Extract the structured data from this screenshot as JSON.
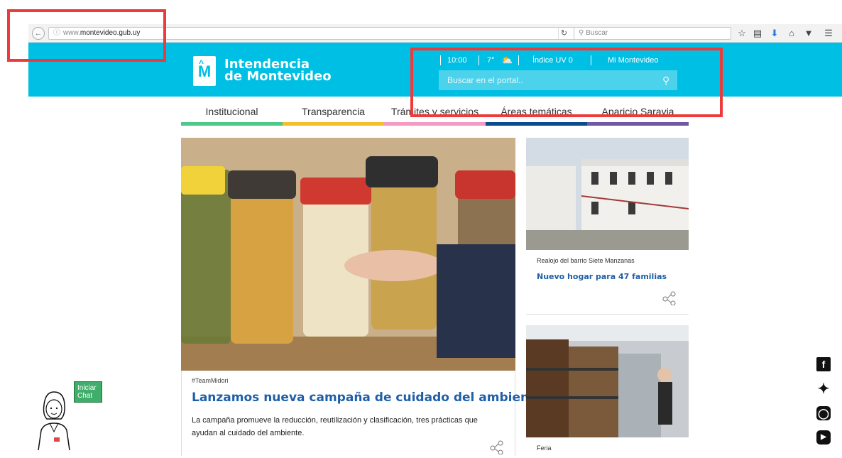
{
  "browser": {
    "url_prefix": "www.",
    "url_host": "montevideo.gub.uy",
    "search_placeholder": "Buscar",
    "info_icon": "info-icon",
    "back_icon": "back-arrow-icon",
    "reload_icon": "reload-icon"
  },
  "header": {
    "logo_letter": "M",
    "logo_line1": "Intendencia",
    "logo_line2": "de Montevideo",
    "time": "10:00",
    "temperature": "7°",
    "uv_index": "Índice UV 0",
    "account_link": "Mi Montevideo",
    "portal_search_placeholder": "Buscar en el portal..",
    "accent_color": "#00bfe4"
  },
  "nav": {
    "items": [
      {
        "label": "Institucional",
        "color": "#4fc98a"
      },
      {
        "label": "Transparencia",
        "color": "#f5be2d"
      },
      {
        "label": "Trámites y servicios",
        "color": "#f59ac3"
      },
      {
        "label": "Áreas temáticas",
        "color": "#0b4b8e"
      },
      {
        "label": "Aparicio Saravia",
        "color": "#6f58a6"
      }
    ]
  },
  "main_article": {
    "tag": "#TeamMidori",
    "title": "Lanzamos nueva campaña de cuidado del ambiente",
    "description": "La campaña promueve la reducción, reutilización y clasificación, tres prácticas que ayudan al cuidado del ambiente."
  },
  "side_articles": [
    {
      "caption": "Realojo del barrio Siete Manzanas",
      "title": "Nuevo hogar para 47 familias"
    },
    {
      "caption": "Feria",
      "title": ""
    }
  ],
  "chat": {
    "label_line1": "Iniciar",
    "label_line2": "Chat"
  },
  "social": [
    "facebook-icon",
    "twitter-icon",
    "instagram-icon",
    "youtube-icon"
  ]
}
